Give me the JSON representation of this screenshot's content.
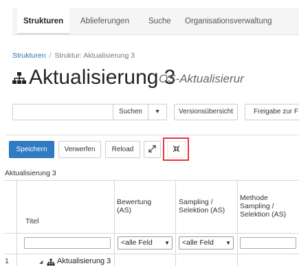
{
  "nav": {
    "tabs": [
      {
        "label": "Strukturen",
        "active": true
      },
      {
        "label": "Ablieferungen",
        "active": false
      },
      {
        "label": "Suche",
        "active": false
      },
      {
        "label": "Organisationsverwaltung",
        "active": false
      }
    ]
  },
  "breadcrumb": {
    "link": "Strukturen",
    "separator": "/",
    "current": "Struktur: Aktualisierung 3"
  },
  "title": {
    "icon": "hierarchy-icon",
    "main": "Aktualisierung 3",
    "sub": "OS-Aktualisierur"
  },
  "search": {
    "value": "",
    "button": "Suchen",
    "caret": "▾"
  },
  "actions": {
    "version": "Versionsübersicht",
    "release": "Freigabe zur F"
  },
  "toolbar": {
    "save": "Speichern",
    "discard": "Verwerfen",
    "reload": "Reload",
    "expand_icon": "expand-arrows-icon",
    "collapse_icon": "collapse-arrows-icon",
    "highlight_color": "#e8333a",
    "primary_color": "#2f7bc4"
  },
  "tree": {
    "caption": "Aktualisierung 3",
    "columns": [
      "Titel",
      "Bewertung\n(AS)",
      "Sampling /\nSelektion (AS)",
      "Methode\nSampling /\nSelektion (AS)"
    ],
    "filters": {
      "title_value": "",
      "bewertung": "<alle Feld",
      "sampling": "<alle Feld",
      "methode_value": ""
    },
    "rows": [
      {
        "num": "1",
        "toggle": "◢",
        "label": "Aktualisierung 3"
      }
    ]
  }
}
